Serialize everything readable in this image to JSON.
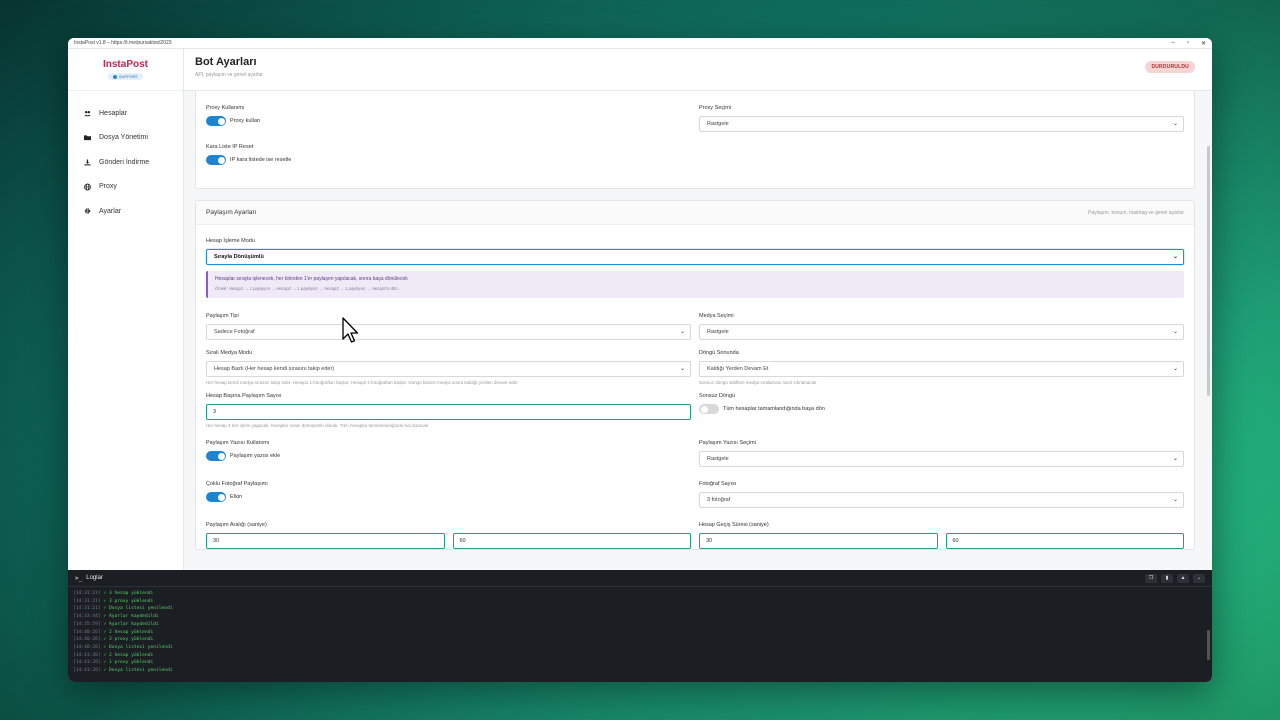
{
  "window": {
    "title": "InstaPost v1.8 – https://t.me/pursaktool2023",
    "controls": [
      "–",
      "▫",
      "✕"
    ]
  },
  "brand": {
    "name": "InstaPost",
    "badge": "SUPPORT"
  },
  "sidebar": {
    "items": [
      {
        "label": "Hesaplar",
        "icon": "users-icon"
      },
      {
        "label": "Dosya Yönetimi",
        "icon": "folder-icon"
      },
      {
        "label": "Gönderi İndirme",
        "icon": "download-icon"
      },
      {
        "label": "Proxy",
        "icon": "globe-icon"
      },
      {
        "label": "Ayarlar",
        "icon": "gear-icon"
      }
    ]
  },
  "header": {
    "title": "Bot Ayarları",
    "subtitle": "API, paylaşım ve genel ayarlar",
    "status": "DURDURULDU"
  },
  "proxy": {
    "usage_label": "Proxy Kullanımı",
    "usage_toggle": "Proxy kullan",
    "usage_on": true,
    "select_label": "Proxy Seçimi",
    "select_value": "Rastgele",
    "blacklist_label": "Kara Liste IP Reset",
    "blacklist_toggle": "IP kara listede ise resetle",
    "blacklist_on": true
  },
  "share": {
    "title": "Paylaşım Ayarları",
    "hint": "Paylaşım, konum, hashtag ve genel ayarlar",
    "mode_label": "Hesap İşleme Modu",
    "mode_value": "Sırayla Dönüşümlü",
    "info_main": "Hesaplar sırayla işlenecek, her birinden 1'er paylaşım yapılacak, sonra başa dönülecek",
    "info_sub": "Örnek: Hesap1 → 1 paylaşım → Hesap2 → 1 paylaşım → Hesap3 → 1 paylaşım → Hesap1'e dön...",
    "type_label": "Paylaşım Tipi",
    "type_value": "Sadece Fotoğraf",
    "media_label": "Medya Seçimi",
    "media_value": "Rastgele",
    "seq_label": "Sıralı Medya Modu",
    "seq_value": "Hesap Bazlı (Her hesap kendi sırasını takip eder)",
    "seq_help": "Her hesap kendi medya sırasını takip eder. Hesap1 1.fotoğraftan başlar, Hesap2 2.fotoğraftan başlar. Döngü bitince medya sonra kaldığı yerden devam eder.",
    "loop_end_label": "Döngü Sonunda",
    "loop_end_value": "Kaldığı Yerden Devam Et",
    "loop_end_help": "Sonsuz döngü aktifken medya sıralaması nasıl sıfırlanacak",
    "per_account_label": "Hesap Başına Paylaşım Sayısı",
    "per_account_value": "3",
    "per_account_help": "Her hesap 3 kez işlem yapacak, hesaplar sırası dönüşümlü olarak. Tüm hesaplar tamamlandığında bot duracak",
    "infinite_label": "Sonsuz Döngü",
    "infinite_toggle": "Tüm hesaplar tamamlandığında başa dön",
    "infinite_on": false,
    "caption_label": "Paylaşım Yazısı Kullanımı",
    "caption_toggle": "Paylaşım yazısı ekle",
    "caption_on": true,
    "caption_select_label": "Paylaşım Yazısı Seçimi",
    "caption_select_value": "Rastgele",
    "multi_label": "Çoklu Fotoğraf Paylaşımı",
    "multi_toggle": "Etkin",
    "multi_on": true,
    "photo_count_label": "Fotoğraf Sayısı",
    "photo_count_value": "3 fotoğraf",
    "interval_label": "Paylaşım Aralığı (saniye)",
    "interval_min": "30",
    "interval_max": "60",
    "switch_label": "Hesap Geçiş Süresi (saniye)",
    "switch_min": "30",
    "switch_max": "60"
  },
  "logs": {
    "title": "Loglar",
    "lines": [
      {
        "ts": "[14:31:21]",
        "msg": "✓ 3 hesap yüklendi"
      },
      {
        "ts": "[14:31:21]",
        "msg": "✓ 3 proxy yüklendi"
      },
      {
        "ts": "[14:31:21]",
        "msg": "✓ Dosya listesi yenilendi"
      },
      {
        "ts": "[14:33:44]",
        "msg": "✓ Ayarlar kaydedildi"
      },
      {
        "ts": "[14:35:59]",
        "msg": "✓ Ayarlar kaydedildi"
      },
      {
        "ts": "[14:40:26]",
        "msg": "✓ 2 hesap yüklendi"
      },
      {
        "ts": "[14:40:26]",
        "msg": "✓ 3 proxy yüklendi"
      },
      {
        "ts": "[14:40:26]",
        "msg": "✓ Dosya listesi yenilendi"
      },
      {
        "ts": "[14:41:20]",
        "msg": "✓ 2 hesap yüklendi"
      },
      {
        "ts": "[14:41:20]",
        "msg": "✓ 1 proxy yüklendi"
      },
      {
        "ts": "[14:41:20]",
        "msg": "✓ Dosya listesi yenilendi"
      }
    ]
  }
}
